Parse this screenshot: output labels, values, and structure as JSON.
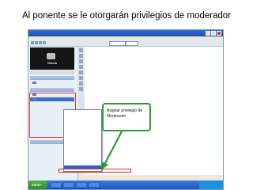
{
  "slide": {
    "title": "Al ponente se le otorgarán privilegios de moderador"
  },
  "callout": {
    "text": "Asignar privilegio de Moderador",
    "border_color": "#2b9a3c"
  },
  "screenshot": {
    "video_name": "Gisela",
    "start_label": "inicio",
    "highlight_color": "#e0282a"
  },
  "icons": {
    "window_close": "close-icon",
    "window_minimize": "minimize-icon",
    "window_maximize": "maximize-icon"
  }
}
